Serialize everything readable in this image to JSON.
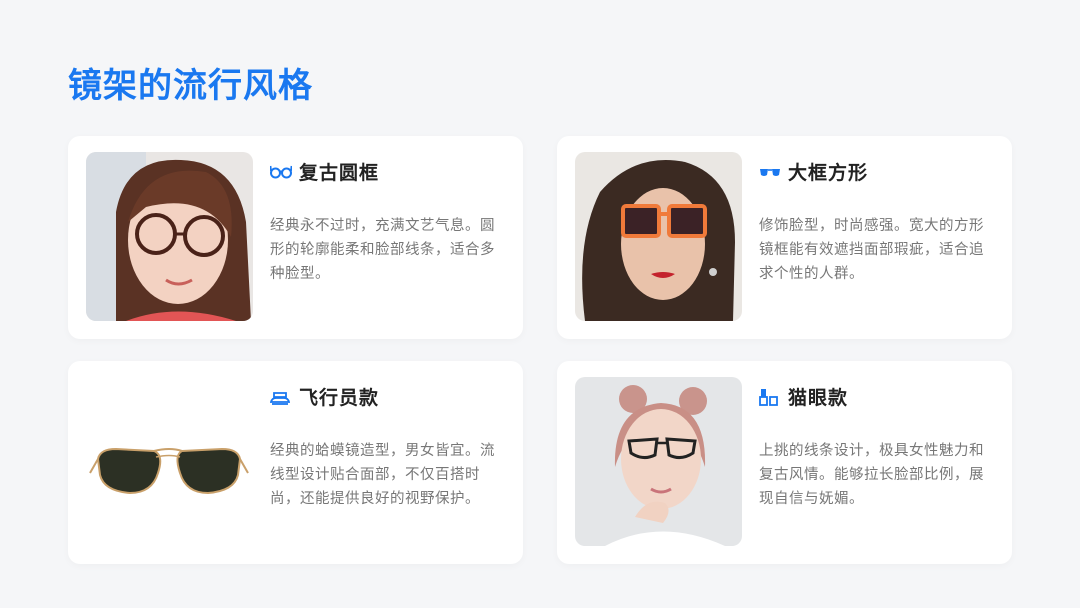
{
  "page": {
    "title": "镜架的流行风格"
  },
  "accent_color": "#1a78f0",
  "cards": [
    {
      "icon": "round-glasses-icon",
      "title": "复古圆框",
      "description": "经典永不过时，充满文艺气息。圆形的轮廓能柔和脸部线条，适合多种脸型。"
    },
    {
      "icon": "square-glasses-icon",
      "title": "大框方形",
      "description": "修饰脸型，时尚感强。宽大的方形镜框能有效遮挡面部瑕疵，适合追求个性的人群。"
    },
    {
      "icon": "aviator-icon",
      "title": "飞行员款",
      "description": "经典的蛤蟆镜造型，男女皆宜。流线型设计贴合面部，不仅百搭时尚，还能提供良好的视野保护。"
    },
    {
      "icon": "lipstick-icon",
      "title": "猫眼款",
      "description": "上挑的线条设计，极具女性魅力和复古风情。能够拉长脸部比例，展现自信与妩媚。"
    }
  ]
}
